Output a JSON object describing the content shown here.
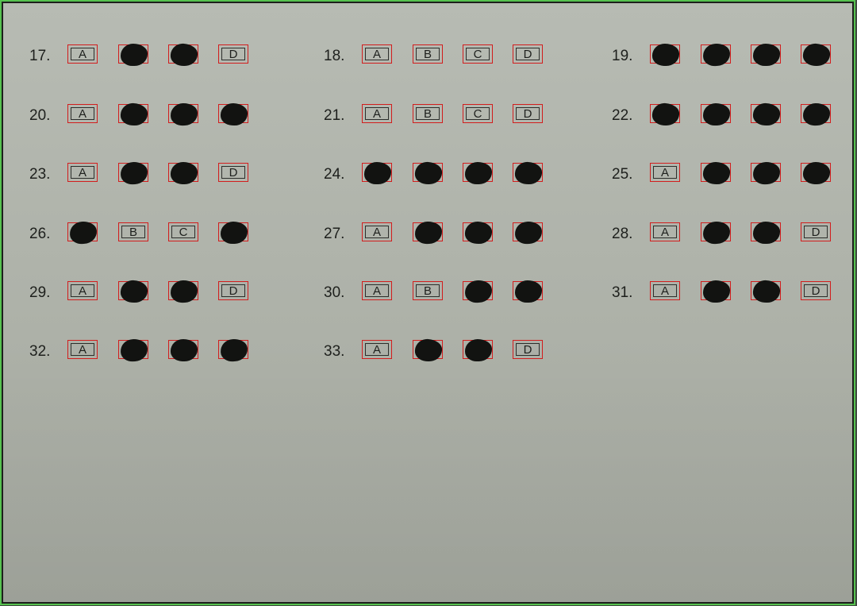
{
  "sheet": {
    "questions": [
      {
        "number": "17.",
        "options": [
          {
            "label": "A",
            "filled": false
          },
          {
            "label": "B",
            "filled": true
          },
          {
            "label": "C",
            "filled": true
          },
          {
            "label": "D",
            "filled": false
          }
        ]
      },
      {
        "number": "18.",
        "options": [
          {
            "label": "A",
            "filled": false
          },
          {
            "label": "B",
            "filled": false
          },
          {
            "label": "C",
            "filled": false
          },
          {
            "label": "D",
            "filled": false
          }
        ]
      },
      {
        "number": "19.",
        "options": [
          {
            "label": "A",
            "filled": true
          },
          {
            "label": "B",
            "filled": true
          },
          {
            "label": "C",
            "filled": true
          },
          {
            "label": "D",
            "filled": true
          }
        ]
      },
      {
        "number": "20.",
        "options": [
          {
            "label": "A",
            "filled": false
          },
          {
            "label": "B",
            "filled": true
          },
          {
            "label": "C",
            "filled": true
          },
          {
            "label": "D",
            "filled": true
          }
        ]
      },
      {
        "number": "21.",
        "options": [
          {
            "label": "A",
            "filled": false
          },
          {
            "label": "B",
            "filled": false
          },
          {
            "label": "C",
            "filled": false
          },
          {
            "label": "D",
            "filled": false
          }
        ]
      },
      {
        "number": "22.",
        "options": [
          {
            "label": "A",
            "filled": true
          },
          {
            "label": "B",
            "filled": true
          },
          {
            "label": "C",
            "filled": true
          },
          {
            "label": "D",
            "filled": true
          }
        ]
      },
      {
        "number": "23.",
        "options": [
          {
            "label": "A",
            "filled": false
          },
          {
            "label": "B",
            "filled": true
          },
          {
            "label": "C",
            "filled": true
          },
          {
            "label": "D",
            "filled": false
          }
        ]
      },
      {
        "number": "24.",
        "options": [
          {
            "label": "A",
            "filled": true
          },
          {
            "label": "B",
            "filled": true
          },
          {
            "label": "C",
            "filled": true
          },
          {
            "label": "D",
            "filled": true
          }
        ]
      },
      {
        "number": "25.",
        "options": [
          {
            "label": "A",
            "filled": false
          },
          {
            "label": "B",
            "filled": true
          },
          {
            "label": "C",
            "filled": true
          },
          {
            "label": "D",
            "filled": true
          }
        ]
      },
      {
        "number": "26.",
        "options": [
          {
            "label": "A",
            "filled": true
          },
          {
            "label": "B",
            "filled": false
          },
          {
            "label": "C",
            "filled": false
          },
          {
            "label": "D",
            "filled": true
          }
        ]
      },
      {
        "number": "27.",
        "options": [
          {
            "label": "A",
            "filled": false
          },
          {
            "label": "B",
            "filled": true
          },
          {
            "label": "C",
            "filled": true
          },
          {
            "label": "D",
            "filled": true
          }
        ]
      },
      {
        "number": "28.",
        "options": [
          {
            "label": "A",
            "filled": false
          },
          {
            "label": "B",
            "filled": true
          },
          {
            "label": "C",
            "filled": true
          },
          {
            "label": "D",
            "filled": false
          }
        ]
      },
      {
        "number": "29.",
        "options": [
          {
            "label": "A",
            "filled": false
          },
          {
            "label": "B",
            "filled": true
          },
          {
            "label": "C",
            "filled": true
          },
          {
            "label": "D",
            "filled": false
          }
        ]
      },
      {
        "number": "30.",
        "options": [
          {
            "label": "A",
            "filled": false
          },
          {
            "label": "B",
            "filled": false
          },
          {
            "label": "C",
            "filled": true
          },
          {
            "label": "D",
            "filled": true
          }
        ]
      },
      {
        "number": "31.",
        "options": [
          {
            "label": "A",
            "filled": false
          },
          {
            "label": "B",
            "filled": true
          },
          {
            "label": "C",
            "filled": true
          },
          {
            "label": "D",
            "filled": false
          }
        ]
      },
      {
        "number": "32.",
        "options": [
          {
            "label": "A",
            "filled": false
          },
          {
            "label": "B",
            "filled": true
          },
          {
            "label": "C",
            "filled": true
          },
          {
            "label": "D",
            "filled": true
          }
        ]
      },
      {
        "number": "33.",
        "options": [
          {
            "label": "A",
            "filled": false
          },
          {
            "label": "B",
            "filled": true
          },
          {
            "label": "C",
            "filled": true
          },
          {
            "label": "D",
            "filled": false
          }
        ]
      }
    ]
  },
  "colors": {
    "detection_box": "#d21d1d",
    "pencil_mark": "#121311",
    "paper": "#b3b7ae",
    "frame": "#56c24f"
  }
}
